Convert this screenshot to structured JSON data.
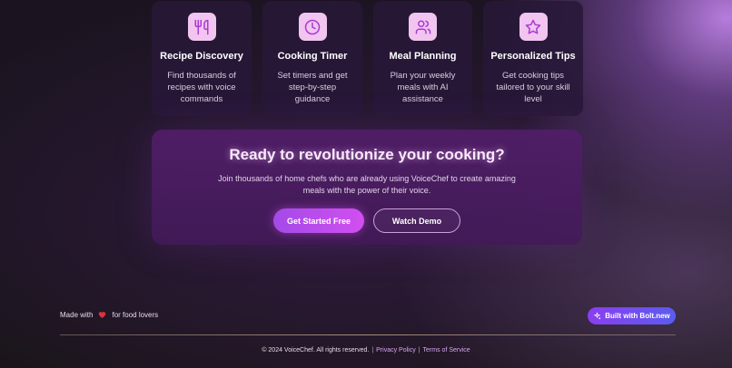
{
  "features": [
    {
      "icon": "utensils-icon",
      "title": "Recipe Discovery",
      "description": "Find thousands of recipes with voice commands"
    },
    {
      "icon": "clock-icon",
      "title": "Cooking Timer",
      "description": "Set timers and get step-by-step guidance"
    },
    {
      "icon": "users-icon",
      "title": "Meal Planning",
      "description": "Plan your weekly meals with AI assistance"
    },
    {
      "icon": "star-icon",
      "title": "Personalized Tips",
      "description": "Get cooking tips tailored to your skill level"
    }
  ],
  "cta": {
    "title": "Ready to revolutionize your cooking?",
    "subtitle": "Join thousands of home chefs who are already using VoiceChef to create amazing meals with the power of their voice.",
    "primary_label": "Get Started Free",
    "secondary_label": "Watch Demo"
  },
  "footer": {
    "made_with_prefix": "Made with",
    "made_with_suffix": "for food lovers",
    "badge_label": "Built with Bolt.new",
    "copyright": "© 2024 VoiceChef. All rights reserved.",
    "separator": "|",
    "privacy_label": "Privacy Policy",
    "terms_label": "Terms of Service"
  },
  "colors": {
    "icon_stroke": "#a83ad6",
    "heart": "#e0323c",
    "accent": "#c44cef"
  }
}
